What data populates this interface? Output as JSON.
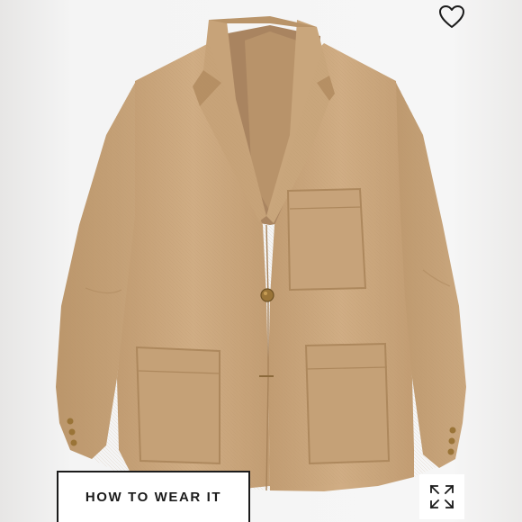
{
  "product_image": {
    "subject": "jacket-photo"
  },
  "actions": {
    "favorite_icon": "heart-icon",
    "how_to_wear_label": "HOW TO WEAR IT",
    "expand_icon": "expand-icon"
  },
  "colors": {
    "jacket_khaki": "#c9a57c",
    "jacket_shadow": "#a98460",
    "button_brass": "#9a7437",
    "label_text": "#1b1b1b",
    "background": "#f4f4f4"
  }
}
